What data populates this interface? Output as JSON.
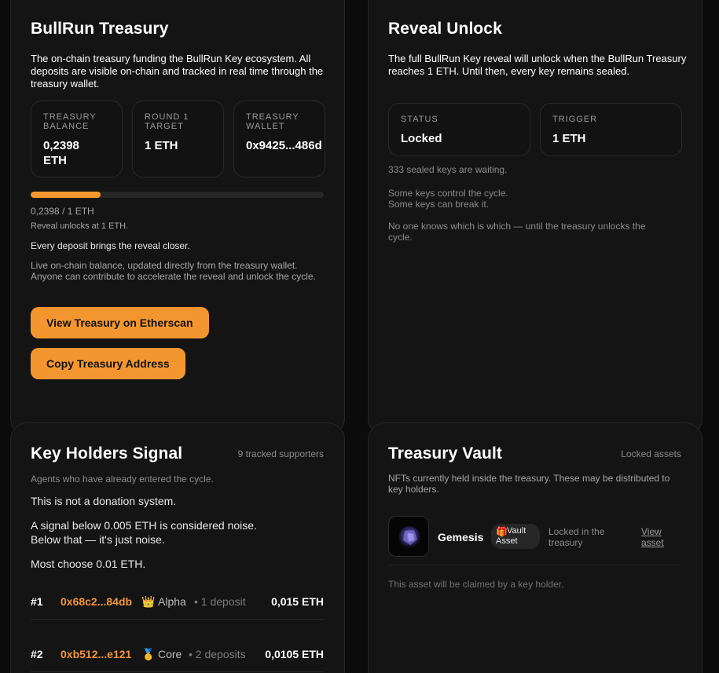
{
  "treasury": {
    "title": "BullRun Treasury",
    "description": "The on-chain treasury funding the BullRun Key ecosystem. All deposits are visible on-chain and tracked in real time through the treasury wallet.",
    "stats": [
      {
        "label_1": "TREASURY",
        "label_2": "BALANCE",
        "value_1": "0,2398",
        "value_2": "ETH"
      },
      {
        "label_1": "ROUND 1",
        "label_2": "TARGET",
        "value_1": "1 ETH",
        "value_2": ""
      },
      {
        "label_1": "TREASURY",
        "label_2": "WALLET",
        "value_1": "0x9425...486d",
        "value_2": ""
      }
    ],
    "progress_fraction": 0.2398,
    "progress_text": "0,2398 / 1 ETH",
    "unlock_note": "Reveal unlocks at 1 ETH.",
    "deposit_note": "Every deposit brings the reveal closer.",
    "live_note": "Live on-chain balance, updated directly from the treasury wallet. Anyone can contribute to accelerate the reveal and unlock the cycle.",
    "view_button": "View Treasury on Etherscan",
    "copy_button": "Copy Treasury Address",
    "accent_color": "#f4962f"
  },
  "reveal": {
    "title": "Reveal Unlock",
    "description": "The full BullRun Key reveal will unlock when the BullRun Treasury reaches 1 ETH. Until then, every key remains sealed.",
    "status_label": "STATUS",
    "status_value": "Locked",
    "trigger_label": "TRIGGER",
    "trigger_value": "1 ETH",
    "waiting": "333 sealed keys are waiting.",
    "line_1": "Some keys control the cycle.",
    "line_2": "Some keys can break it.",
    "mystery": "No one knows which is which — until the treasury unlocks the cycle."
  },
  "holders": {
    "title": "Key Holders Signal",
    "count": "9 tracked supporters",
    "subtitle": "Agents who have already entered the cycle.",
    "statement": "This is not a donation system.",
    "signal_1": "A signal below 0.005 ETH is considered noise.",
    "signal_2": "Below that — it's just noise.",
    "choice": "Most choose 0.01 ETH.",
    "rows": [
      {
        "rank": "#1",
        "address": "0x68c2...84db",
        "tier_icon": "👑",
        "tier": "Alpha",
        "deposits": "• 1 deposit",
        "amount": "0,015 ETH"
      },
      {
        "rank": "#2",
        "address": "0xb512...e121",
        "tier_icon": "🥇",
        "tier": "Core",
        "deposits": "• 2 deposits",
        "amount": "0,0105 ETH"
      }
    ]
  },
  "vault": {
    "title": "Treasury Vault",
    "tag": "Locked assets",
    "description": "NFTs currently held inside the treasury. These may be distributed to key holders.",
    "asset_name": "Gemesis",
    "badge_icon": "🎁",
    "badge_line_1": "Vault",
    "badge_line_2": "Asset",
    "locked_1": "Locked in the",
    "locked_2": "treasury",
    "view_1": "View",
    "view_2": "asset",
    "claim_note": "This asset will be claimed by a key holder."
  }
}
